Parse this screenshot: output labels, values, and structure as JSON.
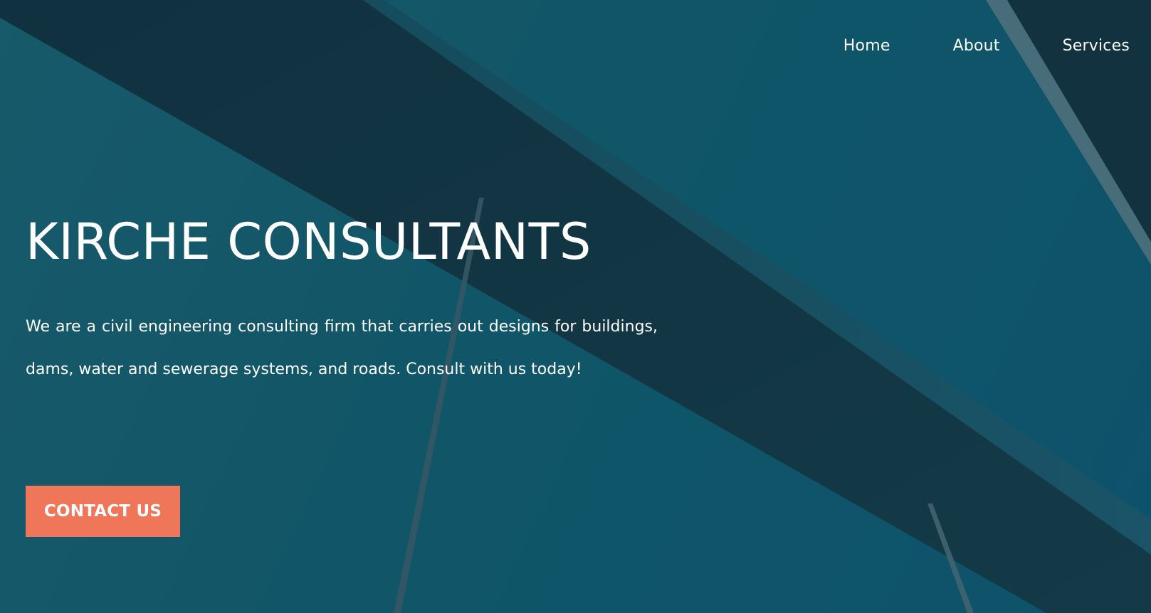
{
  "nav": {
    "items": [
      {
        "label": "Home"
      },
      {
        "label": "About"
      },
      {
        "label": "Services"
      }
    ]
  },
  "hero": {
    "title": "KIRCHE CONSULTANTS",
    "description": "We are a civil engineering consulting firm that carries out designs for buildings, dams, water and sewerage systems, and roads. Consult with us today!",
    "cta_label": "CONTACT US"
  },
  "colors": {
    "background": "#125a6d",
    "beam": "#14323f",
    "cta": "#f0765a",
    "text": "#ffffff"
  }
}
